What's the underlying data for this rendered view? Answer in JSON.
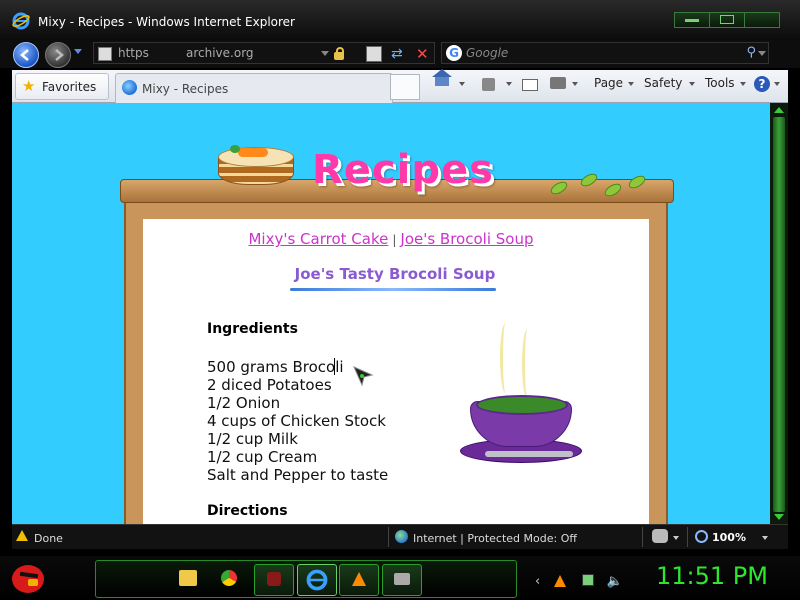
{
  "window": {
    "title": "Mixy - Recipes - Windows Internet Explorer"
  },
  "address_bar": {
    "protocol": "https",
    "host": "archive.org"
  },
  "search": {
    "placeholder": "Google"
  },
  "command_bar": {
    "favorites_label": "Favorites",
    "tab_title": "Mixy - Recipes",
    "page_label": "Page",
    "safety_label": "Safety",
    "tools_label": "Tools"
  },
  "page": {
    "logo_text": "Recipes",
    "links": [
      "Mixy's Carrot Cake",
      "Joe's Brocoli Soup"
    ],
    "link_separator": "|",
    "recipe_title": "Joe's Tasty Brocoli Soup",
    "ingredients_heading": "Ingredients",
    "ingredients": [
      "500 grams Brocoli",
      "2 diced Potatoes",
      "1/2 Onion",
      "4 cups of Chicken Stock",
      "1/2 cup Milk",
      "1/2 cup Cream",
      "Salt and Pepper to taste"
    ],
    "directions_heading": "Directions"
  },
  "status_bar": {
    "status": "Done",
    "zone": "Internet | Protected Mode: Off",
    "zoom": "100%"
  },
  "taskbar": {
    "clock": "11:51 PM"
  },
  "colors": {
    "page_background": "#33ccff",
    "link": "#cc33cc",
    "recipe_title": "#8a5ad0",
    "logo": "#ff3aa8",
    "clock": "#2ee62e"
  }
}
